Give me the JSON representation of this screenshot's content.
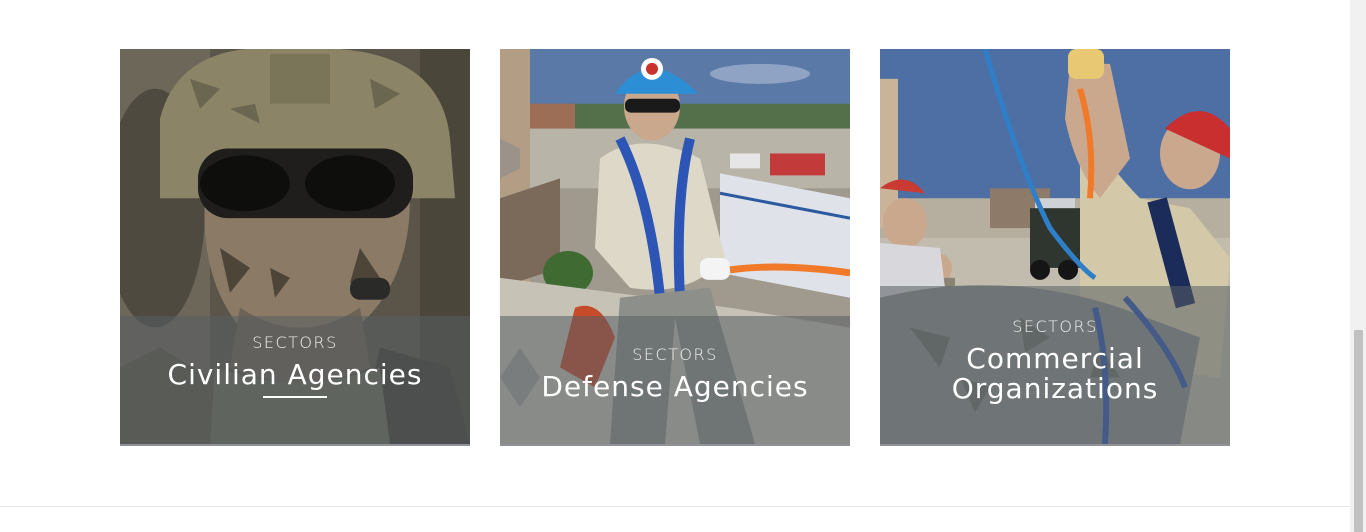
{
  "sectors": [
    {
      "kicker": "SECTORS",
      "title": "Civilian Agencies"
    },
    {
      "kicker": "SECTORS",
      "title": "Defense Agencies"
    },
    {
      "kicker": "SECTORS",
      "title": "Commercial Organizations"
    }
  ]
}
